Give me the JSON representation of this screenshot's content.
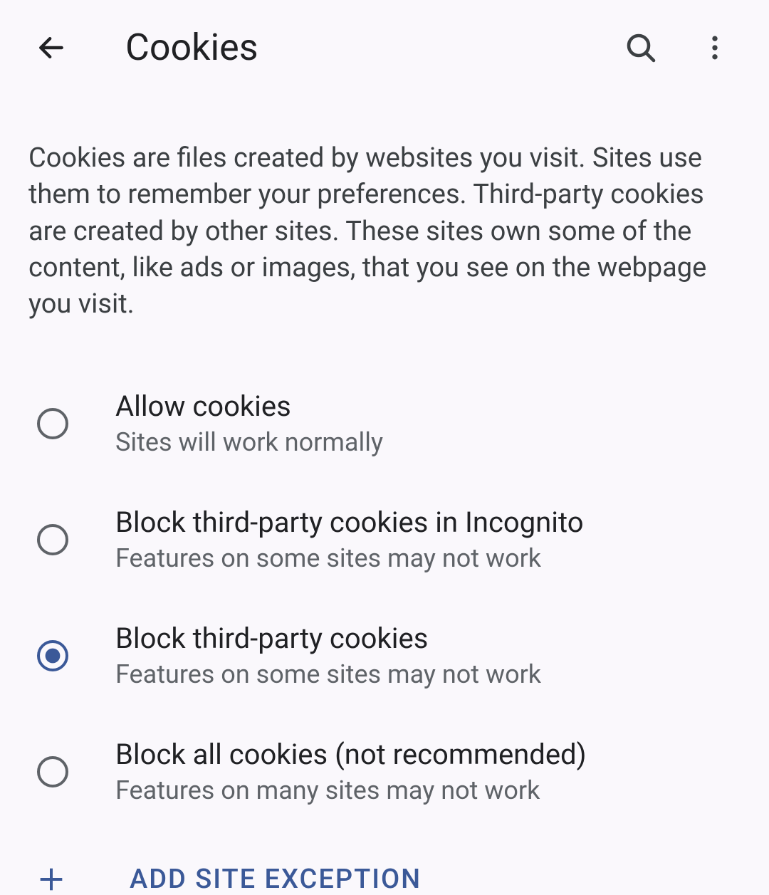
{
  "header": {
    "title": "Cookies"
  },
  "description": "Cookies are files created by websites you visit. Sites use them to remember your preferences. Third-party cookies are created by other sites. These sites own some of the content, like ads or images, that you see on the webpage you visit.",
  "options": [
    {
      "title": "Allow cookies",
      "subtitle": "Sites will work normally",
      "selected": false
    },
    {
      "title": "Block third-party cookies in Incognito",
      "subtitle": "Features on some sites may not work",
      "selected": false
    },
    {
      "title": "Block third-party cookies",
      "subtitle": "Features on some sites may not work",
      "selected": true
    },
    {
      "title": "Block all cookies (not recommended)",
      "subtitle": "Features on many sites may not work",
      "selected": false
    }
  ],
  "exception": {
    "label": "ADD SITE EXCEPTION"
  },
  "colors": {
    "accent": "#3b5998",
    "icon": "#3c4043",
    "radioOff": "#5f6368",
    "radioOn": "#3b5998"
  }
}
